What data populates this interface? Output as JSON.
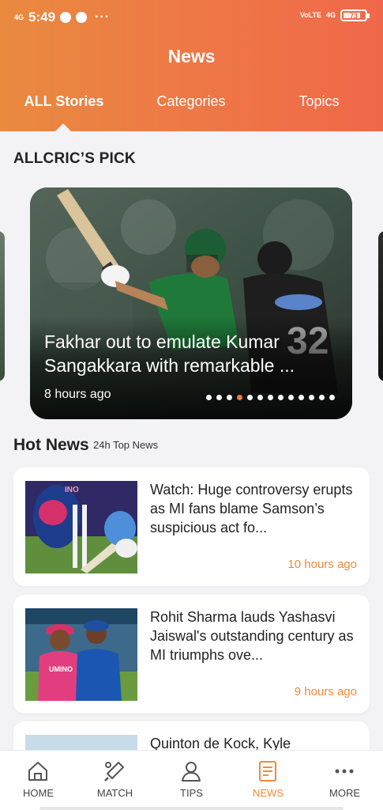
{
  "status_bar": {
    "network_left": "4G",
    "time": "5:49",
    "more": "···",
    "volte": "VoLTE",
    "network_right": "4G",
    "battery": "73"
  },
  "header": {
    "title": "News",
    "tabs": [
      {
        "label": "ALL Stories",
        "active": true
      },
      {
        "label": "Categories",
        "active": false
      },
      {
        "label": "Topics",
        "active": false
      }
    ]
  },
  "pick": {
    "section_title": "ALLCRIC’S PICK",
    "headline": "Fakhar out to emulate Kumar Sangakkara with remarkable ...",
    "time": "8 hours ago",
    "dots_count": 13,
    "active_dot": 3
  },
  "hot_news": {
    "title": "Hot News",
    "subtitle": "24h Top News",
    "items": [
      {
        "headline": "Watch: Huge controversy erupts as MI fans blame Samson’s suspicious act fo...",
        "time": "10 hours ago"
      },
      {
        "headline": "Rohit Sharma lauds Yashasvi Jaiswal's outstanding century as MI triumphs ove...",
        "time": "9 hours ago"
      },
      {
        "headline": "Quinton de Kock, Kyle",
        "time": ""
      }
    ]
  },
  "bottom_nav": {
    "items": [
      {
        "label": "HOME",
        "icon": "home-icon",
        "active": false
      },
      {
        "label": "MATCH",
        "icon": "cricket-bat-icon",
        "active": false
      },
      {
        "label": "TIPS",
        "icon": "person-icon",
        "active": false
      },
      {
        "label": "NEWS",
        "icon": "news-icon",
        "active": true
      },
      {
        "label": "MORE",
        "icon": "more-icon",
        "active": false
      }
    ]
  },
  "colors": {
    "accent": "#f08a3a",
    "header_gradient_start": "#e98a3f",
    "header_gradient_end": "#f0684a"
  }
}
